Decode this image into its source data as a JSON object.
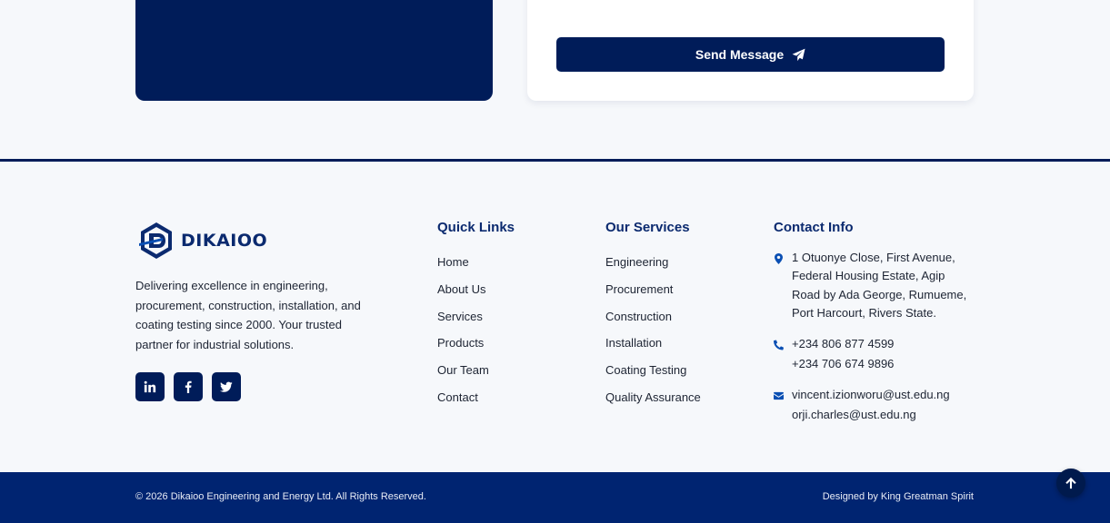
{
  "contact_form": {
    "send_label": "Send Message"
  },
  "footer": {
    "brand": {
      "logo_text": "DIKAIOO",
      "description": "Delivering excellence in engineering, procurement, construction, installation, and coating testing since 2000. Your trusted partner for industrial solutions.",
      "socials": [
        {
          "icon": "linkedin-icon"
        },
        {
          "icon": "facebook-icon"
        },
        {
          "icon": "twitter-icon"
        }
      ]
    },
    "quick_links": {
      "title": "Quick Links",
      "items": [
        "Home",
        "About Us",
        "Services",
        "Products",
        "Our Team",
        "Contact"
      ]
    },
    "services": {
      "title": "Our Services",
      "items": [
        "Engineering",
        "Procurement",
        "Construction",
        "Installation",
        "Coating Testing",
        "Quality Assurance"
      ]
    },
    "contact": {
      "title": "Contact Info",
      "address": "1 Otuonye Close, First Avenue, Federal Housing Estate, Agip Road by Ada George, Rumueme, Port Harcourt, Rivers State.",
      "phones": [
        "+234 806 877 4599",
        "+234 706 674 9896"
      ],
      "emails": [
        "vincent.izionworu@ust.edu.ng",
        "orji.charles@ust.edu.ng"
      ]
    }
  },
  "bottom_bar": {
    "copyright": "© 2026 Dikaioo Engineering and Energy Ltd. All Rights Reserved.",
    "designed_by": "Designed by King Greatman Spirit"
  },
  "colors": {
    "navy": "#001c59",
    "heading_blue": "#0b2a6f",
    "icon_blue": "#0a4fb3",
    "bottom_bar": "#002471",
    "background": "#f6f8fb"
  }
}
